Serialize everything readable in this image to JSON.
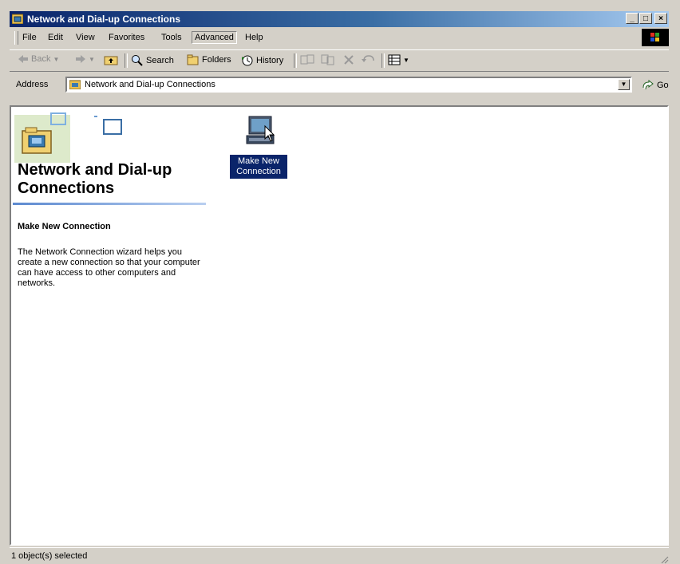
{
  "window": {
    "title": "Network and Dial-up Connections",
    "minimize": "_",
    "maximize": "□",
    "close": "×"
  },
  "menu": {
    "items": [
      "File",
      "Edit",
      "View",
      "Favorites",
      "Tools",
      "Advanced",
      "Help"
    ]
  },
  "toolbar": {
    "back": "Back",
    "search": "Search",
    "folders": "Folders",
    "history": "History"
  },
  "address": {
    "label": "Address",
    "value": "Network and Dial-up Connections",
    "go": "Go"
  },
  "panel": {
    "title": "Network and Dial-up Connections",
    "task_heading": "Make New Connection",
    "task_description": "The Network Connection wizard helps you create a new connection so that your computer can have access to other computers and networks."
  },
  "items": [
    {
      "label": "Make New Connection",
      "selected": true
    }
  ],
  "status": {
    "text": "1 object(s) selected"
  },
  "colors": {
    "titlebar": "#0a246a",
    "selection": "#0a246a",
    "face": "#d4d0c8"
  }
}
